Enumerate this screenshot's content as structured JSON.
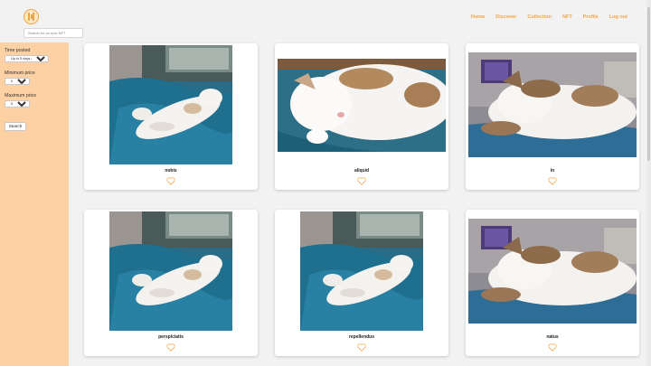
{
  "header": {
    "search_placeholder": "Search for an epic NFT"
  },
  "nav": {
    "items": [
      {
        "label": "Home",
        "name": "nav-home"
      },
      {
        "label": "Discover",
        "name": "nav-discover"
      },
      {
        "label": "Collection",
        "name": "nav-collection"
      },
      {
        "label": "NFT",
        "name": "nav-nft"
      },
      {
        "label": "Profile",
        "name": "nav-profile"
      },
      {
        "label": "Log out",
        "name": "nav-log-out"
      }
    ]
  },
  "filters": {
    "time_label": "Time posted",
    "time_value": "Up to 5 days ago",
    "min_label": "Minimum price",
    "min_value": "0 ETH",
    "max_label": "Maximum price",
    "max_value": "50 ETH",
    "search_button": "Search"
  },
  "cards": [
    {
      "title": "nobis",
      "image": "cat-blanket-photo"
    },
    {
      "title": "aliquid",
      "image": "cat-sleeping-photo"
    },
    {
      "title": "in",
      "image": "cat-couch-photo"
    },
    {
      "title": "perspiciatis",
      "image": "cat-blanket-photo"
    },
    {
      "title": "repellendus",
      "image": "cat-blanket-photo"
    },
    {
      "title": "natus",
      "image": "cat-couch-photo"
    }
  ],
  "colors": {
    "accent": "#f4a443",
    "sidebar": "#fdd1a4",
    "background": "#f2f2f2"
  },
  "icons": {
    "logo": "pause-circle-logo",
    "like": "heart-outline-icon"
  }
}
